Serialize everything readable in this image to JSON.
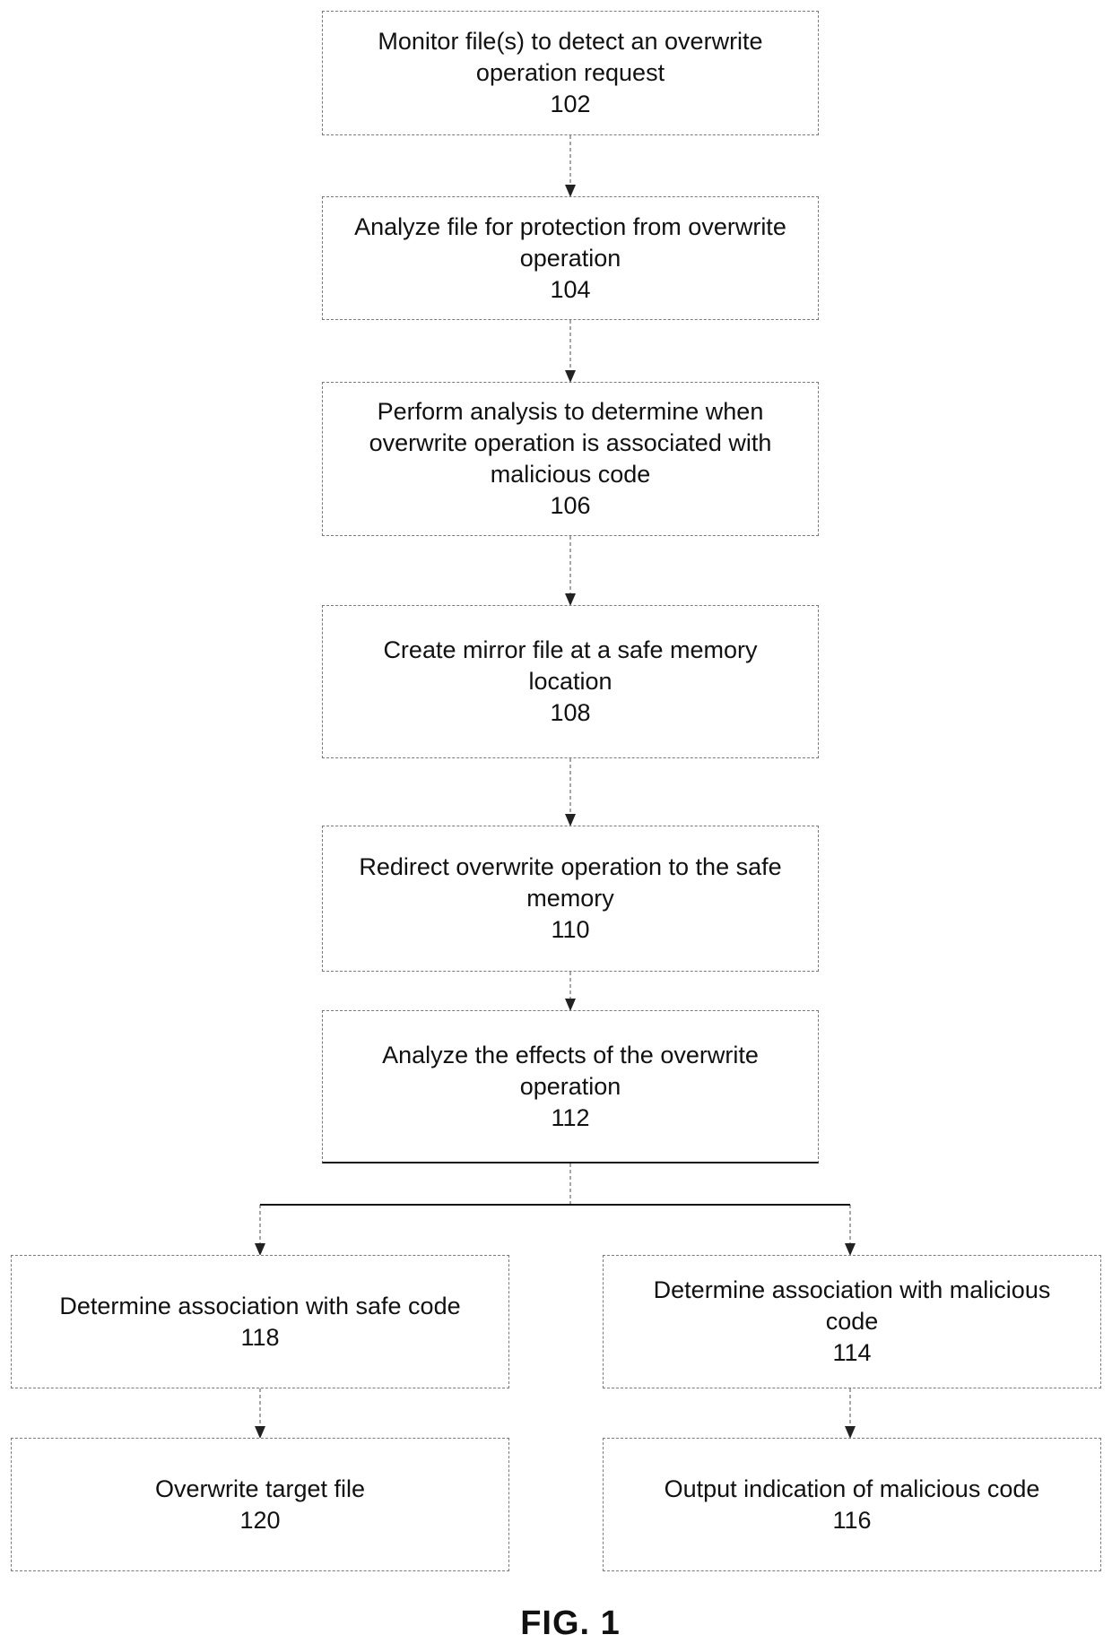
{
  "figure_label": "FIG. 1",
  "steps": {
    "s102": {
      "label": "Monitor file(s) to detect an overwrite operation request",
      "ref": "102"
    },
    "s104": {
      "label": "Analyze file for protection from overwrite operation",
      "ref": "104"
    },
    "s106": {
      "label": "Perform analysis to determine when overwrite operation is associated with malicious code",
      "ref": "106"
    },
    "s108": {
      "label": "Create mirror file at a safe memory location",
      "ref": "108"
    },
    "s110": {
      "label": "Redirect overwrite operation to the safe memory",
      "ref": "110"
    },
    "s112": {
      "label": "Analyze the effects of the overwrite operation",
      "ref": "112"
    },
    "s118": {
      "label": "Determine association with safe code",
      "ref": "118"
    },
    "s114": {
      "label": "Determine association with malicious code",
      "ref": "114"
    },
    "s120": {
      "label": "Overwrite target file",
      "ref": "120"
    },
    "s116": {
      "label": "Output indication of malicious code",
      "ref": "116"
    }
  },
  "edges": [
    [
      "102",
      "104"
    ],
    [
      "104",
      "106"
    ],
    [
      "106",
      "108"
    ],
    [
      "108",
      "110"
    ],
    [
      "110",
      "112"
    ],
    [
      "112",
      "118"
    ],
    [
      "112",
      "114"
    ],
    [
      "118",
      "120"
    ],
    [
      "114",
      "116"
    ]
  ]
}
